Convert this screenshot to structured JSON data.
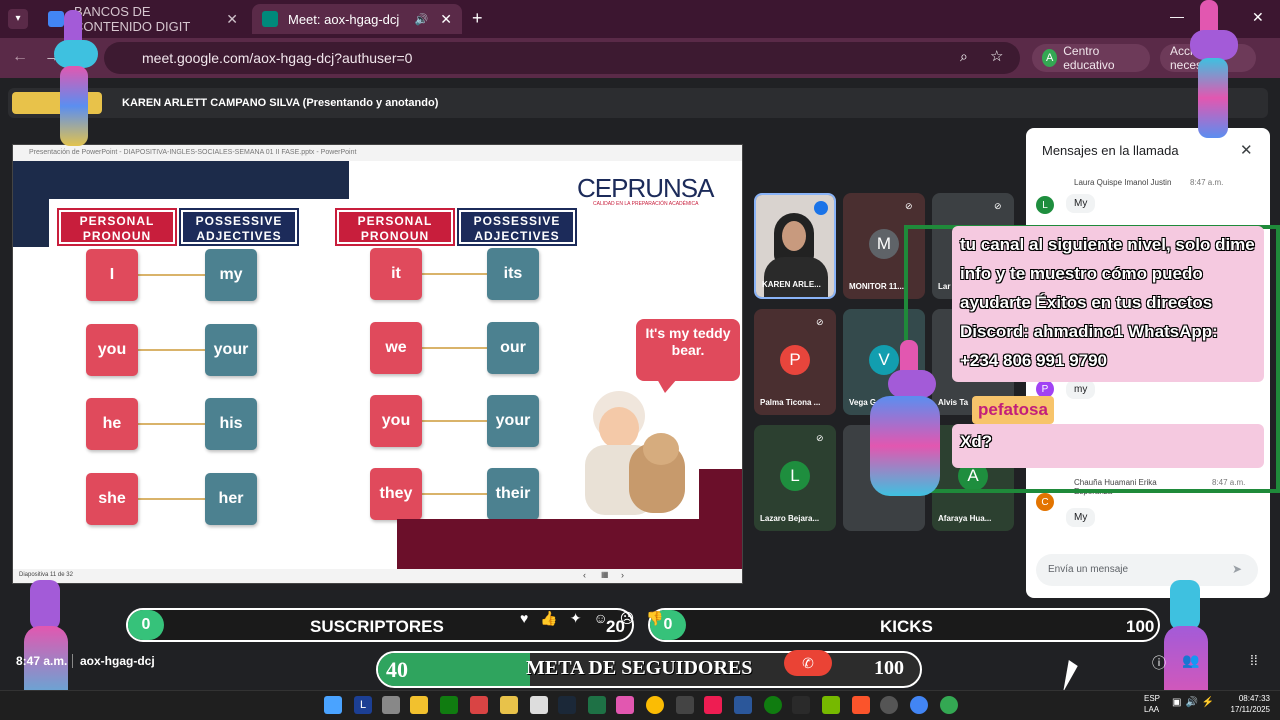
{
  "browser": {
    "tabs": [
      {
        "label": "BANCOS DE CONTENIDO DIGIT",
        "active": false
      },
      {
        "label": "Meet: aox-hgag-dcj",
        "active": true
      }
    ],
    "url": "meet.google.com/aox-hgag-dcj?authuser=0",
    "profile_label": "Centro educativo",
    "profile_initial": "A",
    "action_label": "Acción necesaria"
  },
  "meet": {
    "presenter": "KAREN ARLETT CAMPANO SILVA (Presentando y anotando)",
    "time": "8:47 a.m.",
    "code": "aox-hgag-dcj",
    "tiles": [
      {
        "name": "KAREN ARLE...",
        "initial": "",
        "color": "#5f6368"
      },
      {
        "name": "MONITOR 11...",
        "initial": "M",
        "color": "#5f6368"
      },
      {
        "name": "Lar",
        "initial": "",
        "color": "#5f6368"
      },
      {
        "name": "Palma Ticona ...",
        "initial": "P",
        "color": "#e8453c"
      },
      {
        "name": "Vega Gonz",
        "initial": "V",
        "color": "#129eaf"
      },
      {
        "name": "Alvis Ta",
        "initial": "",
        "color": "#5f6368"
      },
      {
        "name": "Lazaro Bejara...",
        "initial": "L",
        "color": "#1e8e3e"
      },
      {
        "name": "",
        "initial": "",
        "color": "#5f6368"
      },
      {
        "name": "Afaraya Hua...",
        "initial": "A",
        "color": "#1e8e3e"
      }
    ]
  },
  "ppt": {
    "window_title": "Presentación de PowerPoint - DIAPOSITIVA-INGLES-SOCIALES-SEMANA 01 II FASE.pptx - PowerPoint",
    "status": "Diapositiva 11 de 32",
    "brand": "CEPRUNSA",
    "brand_sub": "CALIDAD EN LA PREPARACIÓN ACADÉMICA",
    "headers": [
      "PERSONAL PRONOUN",
      "POSSESSIVE ADJECTIVES",
      "PERSONAL PRONOUN",
      "POSSESSIVE ADJECTIVES"
    ],
    "left_pairs": [
      [
        "I",
        "my"
      ],
      [
        "you",
        "your"
      ],
      [
        "he",
        "his"
      ],
      [
        "she",
        "her"
      ]
    ],
    "right_pairs": [
      [
        "it",
        "its"
      ],
      [
        "we",
        "our"
      ],
      [
        "you",
        "your"
      ],
      [
        "they",
        "their"
      ]
    ],
    "bubble": "It's my teddy bear."
  },
  "chat": {
    "title": "Mensajes en la llamada",
    "messages": [
      {
        "sender": "Laura Quispe Imanol Justin",
        "time": "8:47 a.m.",
        "text": "My",
        "initial": "L",
        "color": "#1e8e3e"
      },
      {
        "sender": "",
        "time": "",
        "text": "my",
        "initial": "P",
        "color": "#a142f4"
      },
      {
        "sender": "Chauña Huamani Erika Esperanza",
        "time": "8:47 a.m.",
        "text": "My",
        "initial": "C",
        "color": "#e37400"
      }
    ],
    "input_placeholder": "Envía un mensaje"
  },
  "overlay": {
    "alert_text": "tu canal al siguiente nivel, solo dime info y te muestro cómo puedo ayudarte Éxitos en tus directos Discord: ahmadino1 WhatsApp: +234 806 991 9790",
    "username": "pefatosa",
    "message": "Xd?",
    "subs": {
      "label": "SUSCRIPTORES",
      "current": "0",
      "goal": "20"
    },
    "kicks": {
      "label": "KICKS",
      "current": "0",
      "goal": "100"
    },
    "meta": {
      "label": "META DE SEGUIDORES",
      "current": "40",
      "goal": "100",
      "progress": 0.4
    }
  },
  "taskbar": {
    "lang1": "ESP",
    "lang2": "LAA",
    "clock": "08:47:33",
    "date": "17/11/2025"
  }
}
